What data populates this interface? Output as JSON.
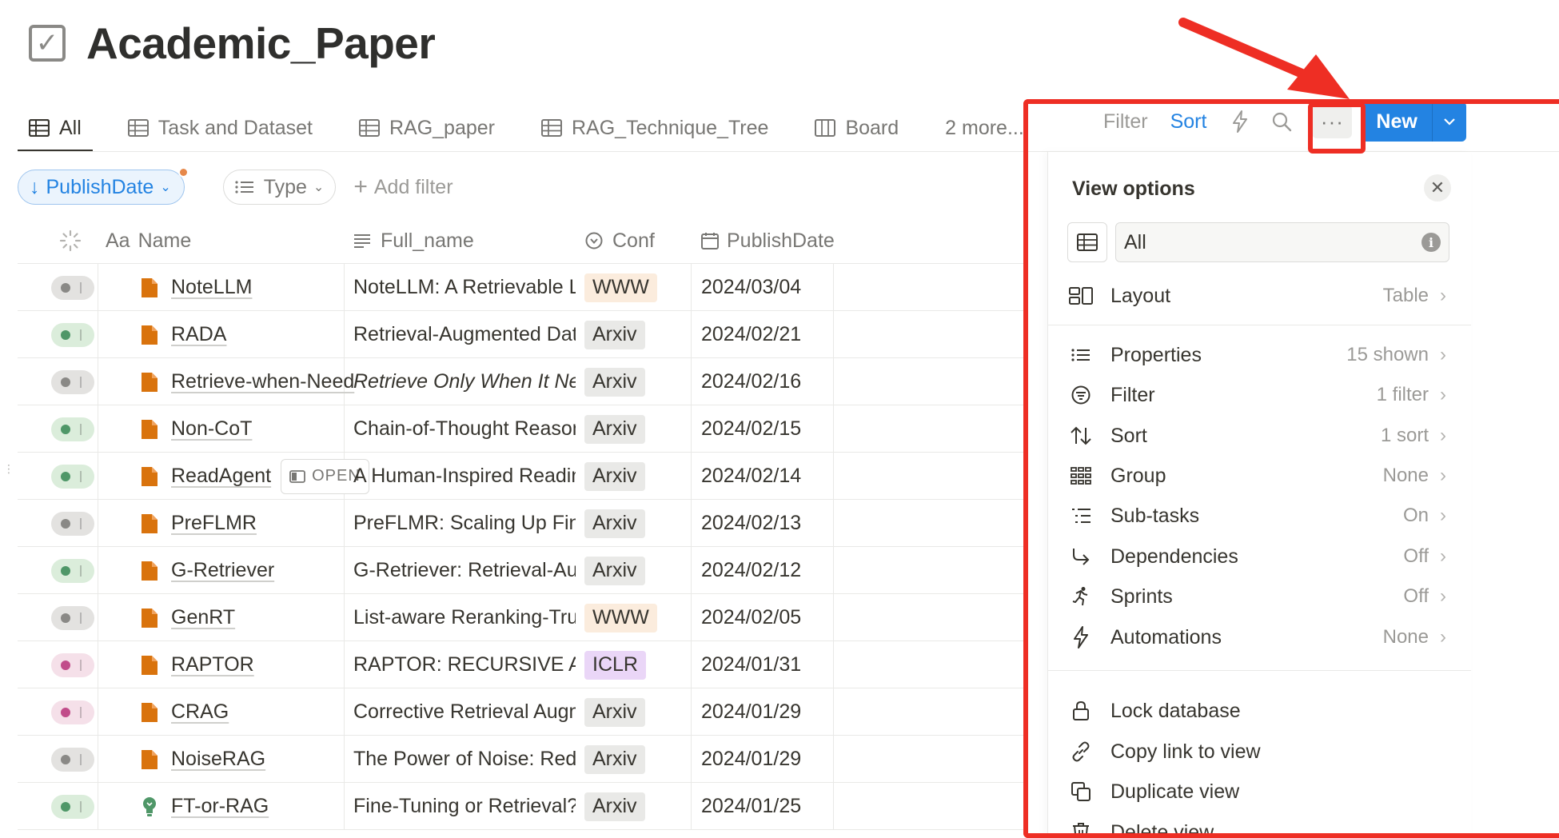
{
  "page": {
    "title": "Academic_Paper",
    "title_icon": "checkbox-icon"
  },
  "tabs": [
    {
      "label": "All",
      "icon": "table-icon",
      "active": true
    },
    {
      "label": "Task and Dataset",
      "icon": "table-icon"
    },
    {
      "label": "RAG_paper",
      "icon": "table-icon"
    },
    {
      "label": "RAG_Technique_Tree",
      "icon": "table-icon"
    },
    {
      "label": "Board",
      "icon": "board-icon"
    },
    {
      "label": "2 more...",
      "icon": ""
    }
  ],
  "toolbar": {
    "filter_label": "Filter",
    "sort_label": "Sort",
    "new_label": "New",
    "more_label": "···",
    "accent": "#2383e2"
  },
  "filters": {
    "sort_chip": "PublishDate",
    "type_chip": "Type",
    "add_filter": "Add filter"
  },
  "columns": {
    "name": "Name",
    "name_prefix": "Aa",
    "full_name": "Full_name",
    "conf": "Conf",
    "publish_date": "PublishDate"
  },
  "rows": [
    {
      "status": "grey",
      "icon": "page",
      "name": "NoteLLM",
      "full_name": "NoteLLM: A Retrievable Large",
      "conf": "WWW",
      "date": "2024/03/04"
    },
    {
      "status": "green",
      "icon": "page",
      "name": "RADA",
      "full_name": "Retrieval-Augmented Data Au",
      "conf": "Arxiv",
      "date": "2024/02/21"
    },
    {
      "status": "grey",
      "icon": "page",
      "name": "Retrieve-when-Need",
      "full_name": "Retrieve Only When It Needs:",
      "conf": "Arxiv",
      "date": "2024/02/16",
      "italic": true
    },
    {
      "status": "green",
      "icon": "page",
      "name": "Non-CoT",
      "full_name": "Chain-of-Thought Reasoning W",
      "conf": "Arxiv",
      "date": "2024/02/15"
    },
    {
      "status": "green",
      "icon": "page",
      "name": "ReadAgent",
      "full_name": "A Human-Inspired Reading Ag",
      "conf": "Arxiv",
      "date": "2024/02/14",
      "open": "OPEN"
    },
    {
      "status": "grey",
      "icon": "page",
      "name": "PreFLMR",
      "full_name": "PreFLMR: Scaling Up Fine-Gra",
      "conf": "Arxiv",
      "date": "2024/02/13"
    },
    {
      "status": "green",
      "icon": "page",
      "name": "G-Retriever",
      "full_name": "G-Retriever: Retrieval-Augmen",
      "conf": "Arxiv",
      "date": "2024/02/12"
    },
    {
      "status": "grey",
      "icon": "page",
      "name": "GenRT",
      "full_name": "List-aware Reranking-Truncati",
      "conf": "WWW",
      "date": "2024/02/05"
    },
    {
      "status": "pink",
      "icon": "page",
      "name": "RAPTOR",
      "full_name": "RAPTOR: RECURSIVE ABSTRA",
      "conf": "ICLR",
      "date": "2024/01/31"
    },
    {
      "status": "pink",
      "icon": "page",
      "name": "CRAG",
      "full_name": "Corrective Retrieval Augmente",
      "conf": "Arxiv",
      "date": "2024/01/29"
    },
    {
      "status": "grey",
      "icon": "page",
      "name": "NoiseRAG",
      "full_name": "The Power of Noise: Redefinin",
      "conf": "Arxiv",
      "date": "2024/01/29"
    },
    {
      "status": "green",
      "icon": "bulb",
      "name": "FT-or-RAG",
      "full_name": "Fine-Tuning or Retrieval? Com",
      "conf": "Arxiv",
      "date": "2024/01/25"
    }
  ],
  "view_options": {
    "title": "View options",
    "view_name": "All",
    "items": [
      {
        "label": "Layout",
        "value": "Table",
        "icon": "layout-icon"
      },
      {
        "label": "Properties",
        "value": "15 shown",
        "icon": "list-icon"
      },
      {
        "label": "Filter",
        "value": "1 filter",
        "icon": "filter-icon"
      },
      {
        "label": "Sort",
        "value": "1 sort",
        "icon": "sort-icon"
      },
      {
        "label": "Group",
        "value": "None",
        "icon": "group-icon"
      },
      {
        "label": "Sub-tasks",
        "value": "On",
        "icon": "subtasks-icon"
      },
      {
        "label": "Dependencies",
        "value": "Off",
        "icon": "dependencies-icon"
      },
      {
        "label": "Sprints",
        "value": "Off",
        "icon": "sprints-icon"
      },
      {
        "label": "Automations",
        "value": "None",
        "icon": "automations-icon"
      }
    ],
    "actions": [
      {
        "label": "Lock database",
        "icon": "lock-icon"
      },
      {
        "label": "Copy link to view",
        "icon": "link-icon"
      },
      {
        "label": "Duplicate view",
        "icon": "duplicate-icon"
      },
      {
        "label": "Delete view",
        "icon": "trash-icon"
      }
    ]
  },
  "colors": {
    "status_grey_bg": "#e3e2e0",
    "status_grey_dot": "#8a8986",
    "status_green_bg": "#dbeddb",
    "status_green_dot": "#4f9768",
    "status_pink_bg": "#f5e0e9",
    "status_pink_dot": "#c14c8a",
    "conf_www_bg": "#fbecdd",
    "conf_arxiv_bg": "#e9e9e7",
    "conf_iclr_bg": "#ead6f7",
    "page_icon": "#d9730d",
    "annotation_red": "#ee2e24"
  }
}
